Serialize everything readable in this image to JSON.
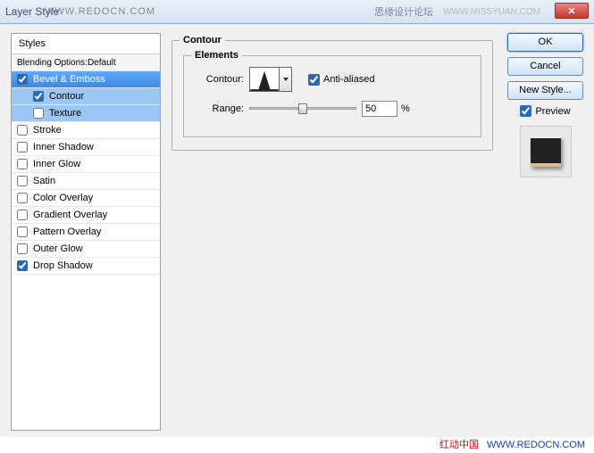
{
  "title": "Layer Style",
  "watermark_top": "WWW.REDOCN.COM",
  "titlebar_right1": "思缘设计论坛",
  "titlebar_right2": "WWW.MISSYUAN.COM",
  "close_glyph": "✕",
  "styles": {
    "header": "Styles",
    "blend": "Blending Options:Default",
    "items": [
      {
        "label": "Bevel & Emboss",
        "checked": true,
        "selected": true
      },
      {
        "label": "Contour",
        "checked": true,
        "indent": true,
        "subselected": true
      },
      {
        "label": "Texture",
        "checked": false,
        "indent": true,
        "subselected": true
      },
      {
        "label": "Stroke",
        "checked": false
      },
      {
        "label": "Inner Shadow",
        "checked": false
      },
      {
        "label": "Inner Glow",
        "checked": false
      },
      {
        "label": "Satin",
        "checked": false
      },
      {
        "label": "Color Overlay",
        "checked": false
      },
      {
        "label": "Gradient Overlay",
        "checked": false
      },
      {
        "label": "Pattern Overlay",
        "checked": false
      },
      {
        "label": "Outer Glow",
        "checked": false
      },
      {
        "label": "Drop Shadow",
        "checked": true
      }
    ]
  },
  "center": {
    "group_title": "Contour",
    "elements_title": "Elements",
    "contour_label": "Contour:",
    "antialiased_label": "Anti-aliased",
    "antialiased_checked": true,
    "range_label": "Range:",
    "range_value": "50",
    "range_unit": "%",
    "range_percent": 50
  },
  "buttons": {
    "ok": "OK",
    "cancel": "Cancel",
    "new_style": "New Style...",
    "preview": "Preview",
    "preview_checked": true
  },
  "footer": {
    "text": "红动中国",
    "url": "WWW.REDOCN.COM"
  }
}
